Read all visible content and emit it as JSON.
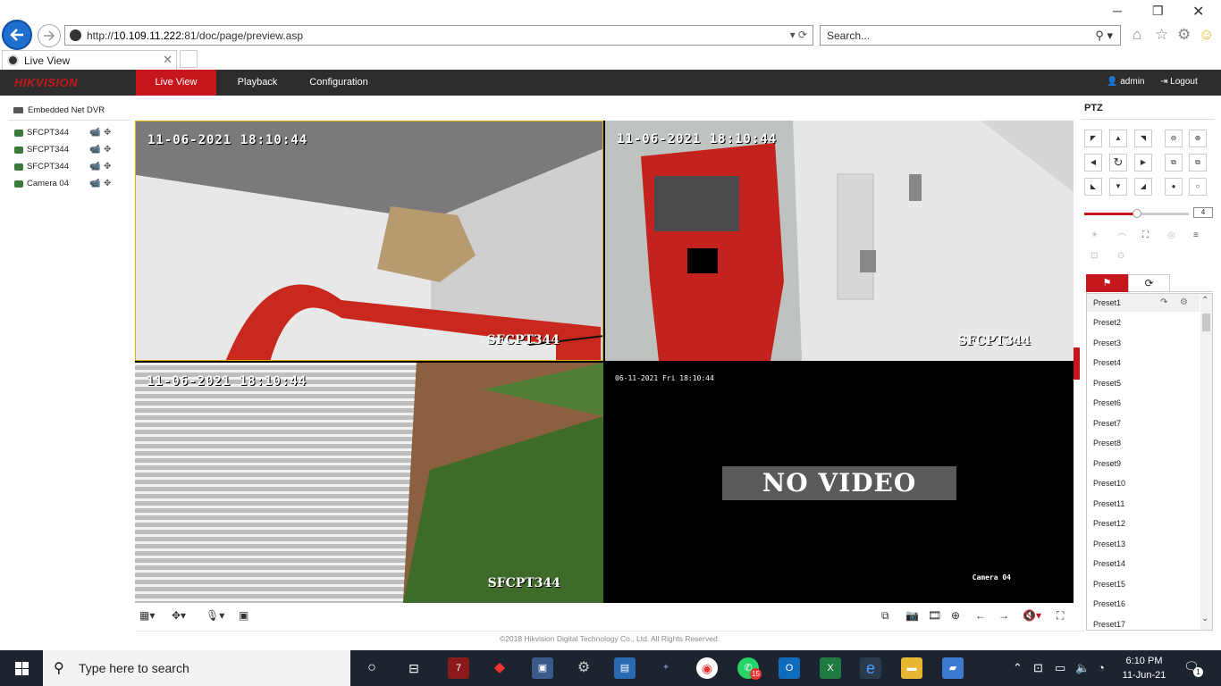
{
  "browser": {
    "url": "http://10.109.11.222:81/doc/page/preview.asp",
    "url_prefix": "http://",
    "url_host": "10.109.11.222",
    "url_rest": ":81/doc/page/preview.asp",
    "search_placeholder": "Search...",
    "tab_title": "Live View"
  },
  "app": {
    "logo": "HIKVISION",
    "nav": [
      "Live View",
      "Playback",
      "Configuration"
    ],
    "user": "admin",
    "logout": "Logout",
    "accent_color": "#c4161c"
  },
  "device_tree": {
    "root": "Embedded Net DVR",
    "cameras": [
      "SFCPT344",
      "SFCPT344",
      "SFCPT344",
      "Camera 04"
    ]
  },
  "video": {
    "tiles": [
      {
        "timestamp": "11-06-2021  18:10:44",
        "name": "SFCPT344"
      },
      {
        "timestamp": "11-06-2021  18:10:44",
        "name": "SFCPT344"
      },
      {
        "timestamp": "11-06-2021  18:10:44",
        "name": "SFCPT344"
      }
    ],
    "tile4": {
      "timestamp": "06-11-2021 Fri 18:10:44",
      "status": "NO VIDEO",
      "name": "Camera 04"
    }
  },
  "ptz": {
    "title": "PTZ",
    "speed": "4",
    "speed_fraction": 0.5,
    "presets": [
      "Preset1",
      "Preset2",
      "Preset3",
      "Preset4",
      "Preset5",
      "Preset6",
      "Preset7",
      "Preset8",
      "Preset9",
      "Preset10",
      "Preset11",
      "Preset12",
      "Preset13",
      "Preset14",
      "Preset15",
      "Preset16",
      "Preset17"
    ]
  },
  "footer": "©2018 Hikvision Digital Technology Co., Ltd. All Rights Reserved.",
  "taskbar": {
    "search_placeholder": "Type here to search",
    "time": "6:10 PM",
    "date": "11-Jun-21",
    "whatsapp_badge": "15",
    "notification_count": "1"
  }
}
